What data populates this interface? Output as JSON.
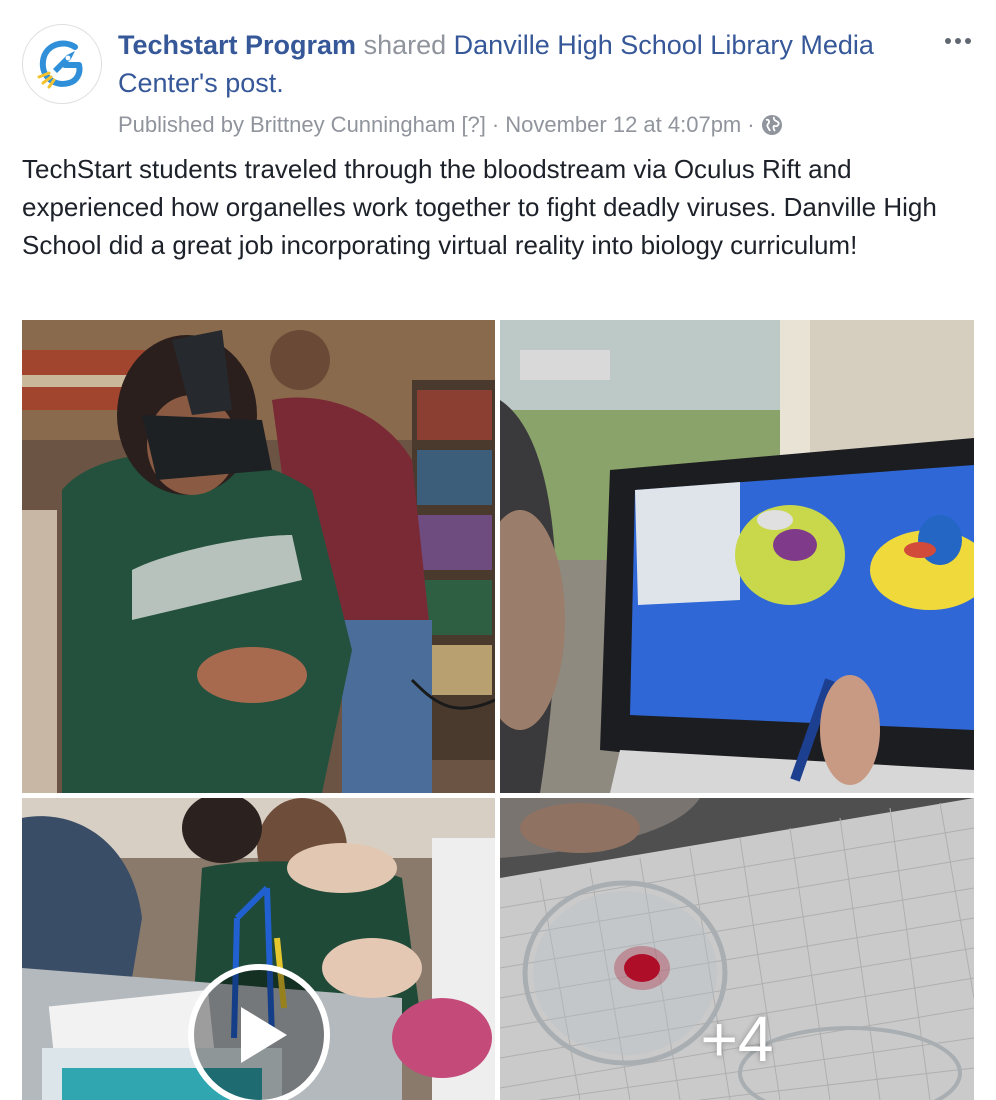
{
  "header": {
    "page_name": "Techstart Program",
    "shared_word": "shared",
    "source_name": "Danville High School Library Media Center",
    "source_suffix": "'s post.",
    "published_by_prefix": "Published by",
    "publisher": "Brittney Cunningham",
    "help_marker": "[?]",
    "separator": "·",
    "timestamp": "November 12 at 4:07pm",
    "audience_icon": "globe-icon",
    "more_icon": "ellipsis-icon"
  },
  "post": {
    "text": "TechStart students traveled through the bloodstream via Oculus Rift and experienced how organelles work together to fight deadly viruses. Danville High School did a great job incorporating virtual reality into biology curriculum!"
  },
  "media": {
    "tiles": [
      {
        "kind": "photo",
        "subject": "student-vr-headset"
      },
      {
        "kind": "photo",
        "subject": "touchscreen-cell-model"
      },
      {
        "kind": "video",
        "subject": "students-building-model",
        "play_icon": "play-icon"
      },
      {
        "kind": "photo",
        "subject": "petri-dish-blood"
      }
    ],
    "more_count_label": "+4"
  },
  "colors": {
    "link": "#365899",
    "muted": "#90949c",
    "text": "#1d2129",
    "logo_blue": "#2f8fd8",
    "logo_yellow": "#f2c230"
  }
}
